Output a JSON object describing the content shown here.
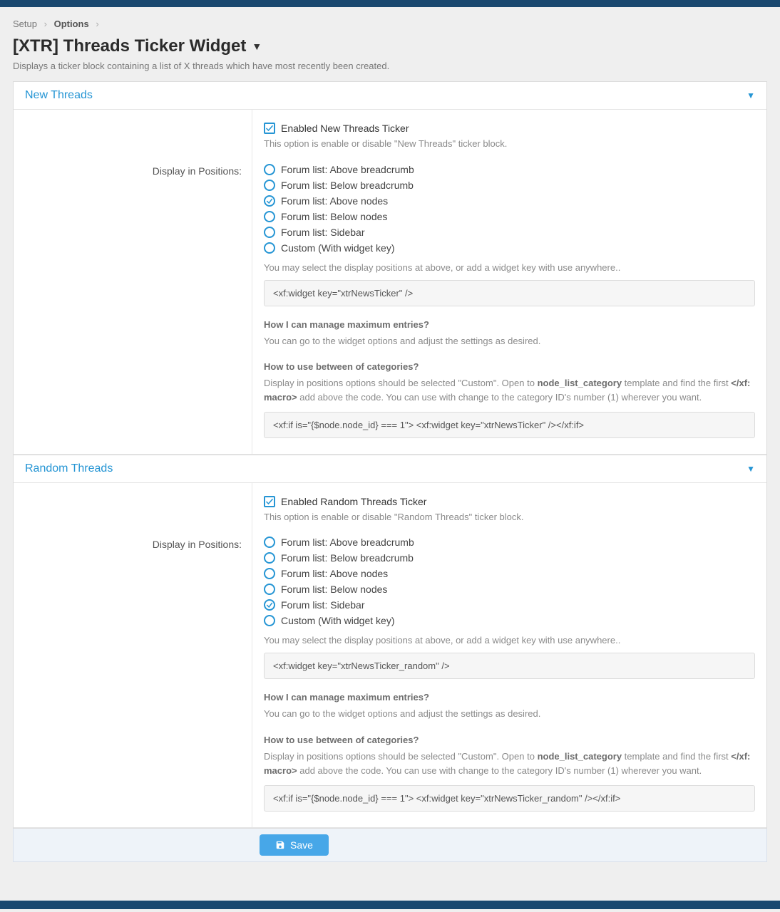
{
  "breadcrumb": {
    "item1": "Setup",
    "item2": "Options"
  },
  "page": {
    "title": "[XTR] Threads Ticker Widget",
    "description": "Displays a ticker block containing a list of X threads which have most recently been created."
  },
  "sections": {
    "new": {
      "title": "New Threads",
      "enable_label": "Enabled New Threads Ticker",
      "enable_hint": "This option is enable or disable \"New Threads\" ticker block.",
      "positions_label": "Display in Positions:",
      "radios": [
        "Forum list: Above breadcrumb",
        "Forum list: Below breadcrumb",
        "Forum list: Above nodes",
        "Forum list: Below nodes",
        "Forum list: Sidebar",
        "Custom (With widget key)"
      ],
      "radio_selected": 2,
      "pos_note": "You may select the display positions at above, or add a widget key with use anywhere..",
      "code1": "<xf:widget key=\"xtrNewsTicker\" />",
      "sub1": "How I can manage maximum entries?",
      "p1": "You can go to the widget options and adjust the settings as desired.",
      "sub2": "How to use between of categories?",
      "p2a": "Display in positions options should be selected \"Custom\". Open to ",
      "p2b": "node_list_category",
      "p2c": " template and find the first ",
      "p2d": "</xf: macro>",
      "p2e": " add above the code. You can use with change to the category ID's number (1) wherever you want.",
      "code2": "<xf:if is=\"{$node.node_id} === 1\">  <xf:widget key=\"xtrNewsTicker\" /></xf:if>"
    },
    "random": {
      "title": "Random Threads",
      "enable_label": "Enabled Random Threads Ticker",
      "enable_hint": "This option is enable or disable \"Random Threads\" ticker block.",
      "positions_label": "Display in Positions:",
      "radios": [
        "Forum list: Above breadcrumb",
        "Forum list: Below breadcrumb",
        "Forum list: Above nodes",
        "Forum list: Below nodes",
        "Forum list: Sidebar",
        "Custom (With widget key)"
      ],
      "radio_selected": 4,
      "pos_note": "You may select the display positions at above, or add a widget key with use anywhere..",
      "code1": "<xf:widget key=\"xtrNewsTicker_random\" />",
      "sub1": "How I can manage maximum entries?",
      "p1": "You can go to the widget options and adjust the settings as desired.",
      "sub2": "How to use between of categories?",
      "p2a": "Display in positions options should be selected \"Custom\". Open to ",
      "p2b": "node_list_category",
      "p2c": " template and find the first ",
      "p2d": "</xf: macro>",
      "p2e": " add above the code. You can use with change to the category ID's number (1) wherever you want.",
      "code2": "<xf:if is=\"{$node.node_id} === 1\">  <xf:widget key=\"xtrNewsTicker_random\" /></xf:if>"
    }
  },
  "save_label": "Save"
}
